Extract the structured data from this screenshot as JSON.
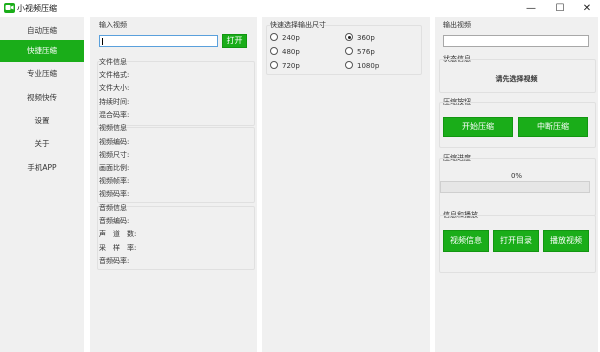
{
  "window": {
    "title": "小视频压缩",
    "minimize": "—",
    "maximize": "☐",
    "close": "✕"
  },
  "sidebar": {
    "items": [
      {
        "label": "自动压缩",
        "active": false
      },
      {
        "label": "快捷压缩",
        "active": true
      },
      {
        "label": "专业压缩",
        "active": false
      },
      {
        "label": "视频快传",
        "active": false
      },
      {
        "label": "设置",
        "active": false
      },
      {
        "label": "关于",
        "active": false
      },
      {
        "label": "手机APP",
        "active": false
      }
    ]
  },
  "input_video": {
    "label": "输入视频",
    "value": "",
    "open_button": "打开"
  },
  "file_info": {
    "title": "文件信息",
    "fields": [
      "文件格式:",
      "文件大小:",
      "持续时间:",
      "混合码率:"
    ]
  },
  "video_info": {
    "title": "视频信息",
    "fields": [
      "视频编码:",
      "视频尺寸:",
      "画面比例:",
      "视频帧率:",
      "视频码率:"
    ]
  },
  "audio_info": {
    "title": "音频信息",
    "fields": [
      "音频编码:",
      "声　道　数:",
      "采　样　率:",
      "音频码率:"
    ]
  },
  "size_select": {
    "title": "快速选择输出尺寸",
    "options": [
      {
        "label": "240p",
        "checked": false
      },
      {
        "label": "360p",
        "checked": true
      },
      {
        "label": "480p",
        "checked": false
      },
      {
        "label": "576p",
        "checked": false
      },
      {
        "label": "720p",
        "checked": false
      },
      {
        "label": "1080p",
        "checked": false
      }
    ]
  },
  "output_video": {
    "label": "输出视频",
    "value": ""
  },
  "status": {
    "title": "状态信息",
    "message": "请先选择视频"
  },
  "compress_buttons": {
    "title": "压缩按钮",
    "start": "开始压缩",
    "stop": "中断压缩"
  },
  "progress": {
    "title": "压缩进度",
    "percent_text": "0%",
    "value": 0
  },
  "info_play": {
    "title": "信息和播放",
    "video_info": "视频信息",
    "open_dir": "打开目录",
    "play": "播放视频"
  },
  "colors": {
    "accent": "#1aad19"
  }
}
